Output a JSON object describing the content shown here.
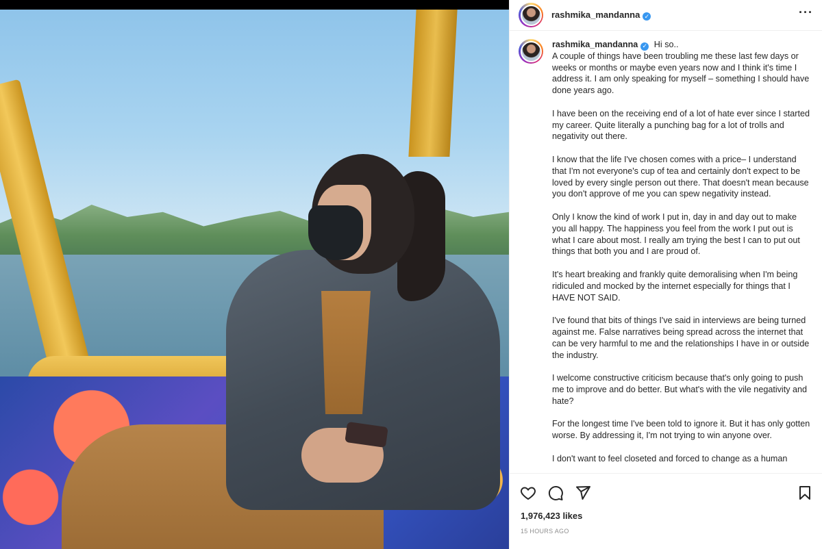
{
  "post": {
    "username": "rashmika_mandanna",
    "verified_glyph": "✓",
    "more_icon": "···"
  },
  "caption": {
    "username": "rashmika_mandanna",
    "paragraphs": [
      "Hi so..\nA couple of things have been troubling me these last few days or weeks or months or maybe even years now and I think it's time I address it. I am only speaking for myself – something I should have done years ago.",
      "I have been on the receiving end of a lot of hate ever since I started my career. Quite literally a punching bag for a lot of trolls and negativity out there.",
      "I know that the life I've chosen comes with a price– I understand that I'm not everyone's cup of tea and certainly don't expect to be loved by every single person out there. That doesn't mean because you don't approve of me you can spew negativity instead.",
      "Only I know the kind of work I put in, day in and day out to make you all happy. The happiness you feel from the work I put out is what I care about most. I really am trying the best I can to put out things that both you and I are proud of.",
      "It's heart breaking and frankly quite demoralising when I'm being ridiculed and mocked by the internet especially for things that I HAVE NOT SAID.",
      "I've found that bits of things I've said in interviews are being turned against me. False narratives being spread across the internet that can be very harmful to me and the relationships I have in or outside the industry.",
      "I welcome constructive criticism because that's only going to push me to improve and do better. But what's with the vile negativity and hate?",
      "For the longest time I've been told to ignore it. But it has only gotten worse. By addressing it, I'm not trying to win anyone over.",
      "I don't want to feel closeted and forced to change as a human"
    ]
  },
  "engagement": {
    "likes": "1,976,423 likes",
    "timestamp": "15 HOURS AGO"
  },
  "icons": {
    "like": "heart-icon",
    "comment": "comment-icon",
    "share": "share-icon",
    "save": "bookmark-icon"
  }
}
